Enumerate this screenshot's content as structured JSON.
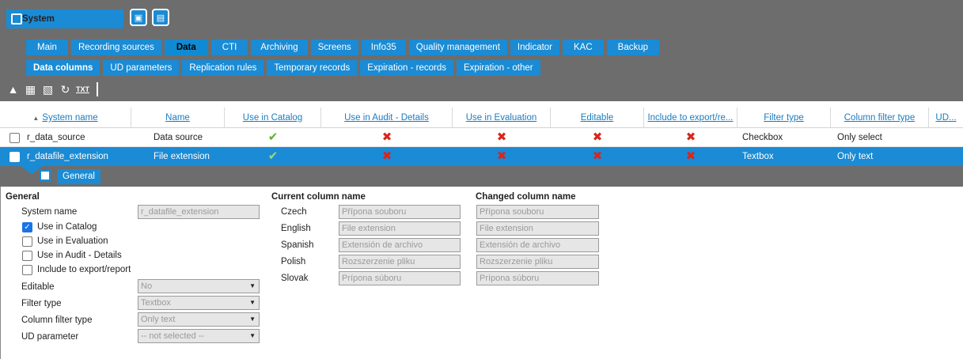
{
  "system_tab": {
    "label": "System"
  },
  "top_icons": [
    "monitor-icon",
    "save-disk-icon"
  ],
  "main_tabs": [
    {
      "label": "Main"
    },
    {
      "label": "Recording sources"
    },
    {
      "label": "Data",
      "active": true
    },
    {
      "label": "CTI"
    },
    {
      "label": "Archiving"
    },
    {
      "label": "Screens"
    },
    {
      "label": "Info35"
    },
    {
      "label": "Quality management"
    },
    {
      "label": "Indicator"
    },
    {
      "label": "KAC"
    },
    {
      "label": "Backup"
    }
  ],
  "sub_tabs": [
    {
      "label": "Data columns",
      "active": true
    },
    {
      "label": "UD parameters"
    },
    {
      "label": "Replication rules"
    },
    {
      "label": "Temporary records"
    },
    {
      "label": "Expiration - records"
    },
    {
      "label": "Expiration - other"
    }
  ],
  "toolbar_icons": [
    "import-icon",
    "group-add-icon",
    "group-remove-icon",
    "refresh-doc-icon",
    "export-txt-icon"
  ],
  "table": {
    "columns": [
      "System name",
      "Name",
      "Use in Catalog",
      "Use in Audit - Details",
      "Use in Evaluation",
      "Editable",
      "Include to export/re...",
      "Filter type",
      "Column filter type",
      "UD..."
    ],
    "rows": [
      {
        "system_name": "r_data_source",
        "name": "Data source",
        "use_in_catalog": "yes",
        "use_in_audit": "no",
        "use_in_evaluation": "no",
        "editable": "no",
        "include_export": "no",
        "filter_type": "Checkbox",
        "column_filter_type": "Only select",
        "selected": false
      },
      {
        "system_name": "r_datafile_extension",
        "name": "File extension",
        "use_in_catalog": "yes",
        "use_in_audit": "no",
        "use_in_evaluation": "no",
        "editable": "no",
        "include_export": "no",
        "filter_type": "Textbox",
        "column_filter_type": "Only text",
        "selected": true
      }
    ]
  },
  "detail": {
    "tab_label": "General",
    "general": {
      "title": "General",
      "system_name_label": "System name",
      "system_name_value": "r_datafile_extension",
      "use_in_catalog_label": "Use in Catalog",
      "use_in_catalog": true,
      "use_in_evaluation_label": "Use in Evaluation",
      "use_in_evaluation": false,
      "use_in_audit_label": "Use in Audit - Details",
      "use_in_audit": false,
      "include_export_label": "Include to export/report",
      "include_export": false,
      "editable_label": "Editable",
      "editable_value": "No",
      "filter_type_label": "Filter type",
      "filter_type_value": "Textbox",
      "column_filter_type_label": "Column filter type",
      "column_filter_type_value": "Only text",
      "ud_parameter_label": "UD parameter",
      "ud_parameter_value": "-- not selected --"
    },
    "names": {
      "current_title": "Current column name",
      "changed_title": "Changed column name",
      "languages": [
        {
          "lang": "Czech",
          "current": "Přípona souboru",
          "changed": "Přípona souboru"
        },
        {
          "lang": "English",
          "current": "File extension",
          "changed": "File extension"
        },
        {
          "lang": "Spanish",
          "current": "Extensión de archivo",
          "changed": "Extensión de archivo"
        },
        {
          "lang": "Polish",
          "current": "Rozszerzenie pliku",
          "changed": "Rozszerzenie pliku"
        },
        {
          "lang": "Slovak",
          "current": "Prípona súboru",
          "changed": "Prípona súboru"
        }
      ]
    }
  },
  "colors": {
    "accent": "#1a8bd4",
    "chrome": "#6d6d6d",
    "check": "#5db42a",
    "cross": "#d8261c"
  }
}
